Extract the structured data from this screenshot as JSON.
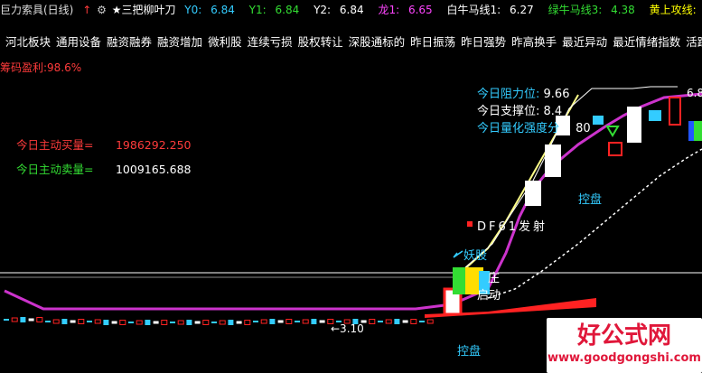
{
  "header": {
    "indicator_name": "巨力索具(日线)",
    "arrows": "↑",
    "gear": "⚙",
    "formula": "★三把柳叶刀",
    "y0_label": "Y0:",
    "y0_value": "6.84",
    "y1_label": "Y1:",
    "y1_value": "6.84",
    "y2_label": "Y2:",
    "y2_value": "6.84",
    "dragon_label": "龙1:",
    "dragon_value": "6.65",
    "white_label": "白牛马线1:",
    "white_value": "6.27",
    "green_label": "绿牛马线3:",
    "green_value": "4.38",
    "yellow_label": "黄上攻线:",
    "yellow_value": "-"
  },
  "sectors": [
    "河北板块",
    "通用设备",
    "融资融券",
    "融资增加",
    "微利股",
    "连续亏损",
    "股权转让",
    "深股通标的",
    "昨日振荡",
    "昨日强势",
    "昨高换手",
    "最近异动",
    "最近情绪指数",
    "活跃"
  ],
  "chip_profit": "筹码盈利:98.6%",
  "buy": {
    "label": "今日主动买量=",
    "value": "1986292.250"
  },
  "sell": {
    "label": "今日主动卖量=",
    "value": "1009165.688"
  },
  "resistance": {
    "label": "今日阻力位:",
    "value": "9.66"
  },
  "support": {
    "label": "今日支撑位:",
    "value": "8.4"
  },
  "quant": {
    "label": "今日量化强度分",
    "value": "80"
  },
  "annotations": {
    "df": "DF61发射",
    "demon": "妖股",
    "control1": "控盘",
    "control2": "控盘",
    "start_a": "庄",
    "start_b": "启动",
    "low_price": "←3.10",
    "high_price": "6.8"
  },
  "watermark": {
    "title": "好公式网",
    "url": "www.goodgongshi.com"
  },
  "colors": {
    "red": "#ff3b3b",
    "green": "#33dd33",
    "cyan": "#33ccff",
    "yellow": "#ffff00",
    "magenta": "#cc33cc"
  }
}
